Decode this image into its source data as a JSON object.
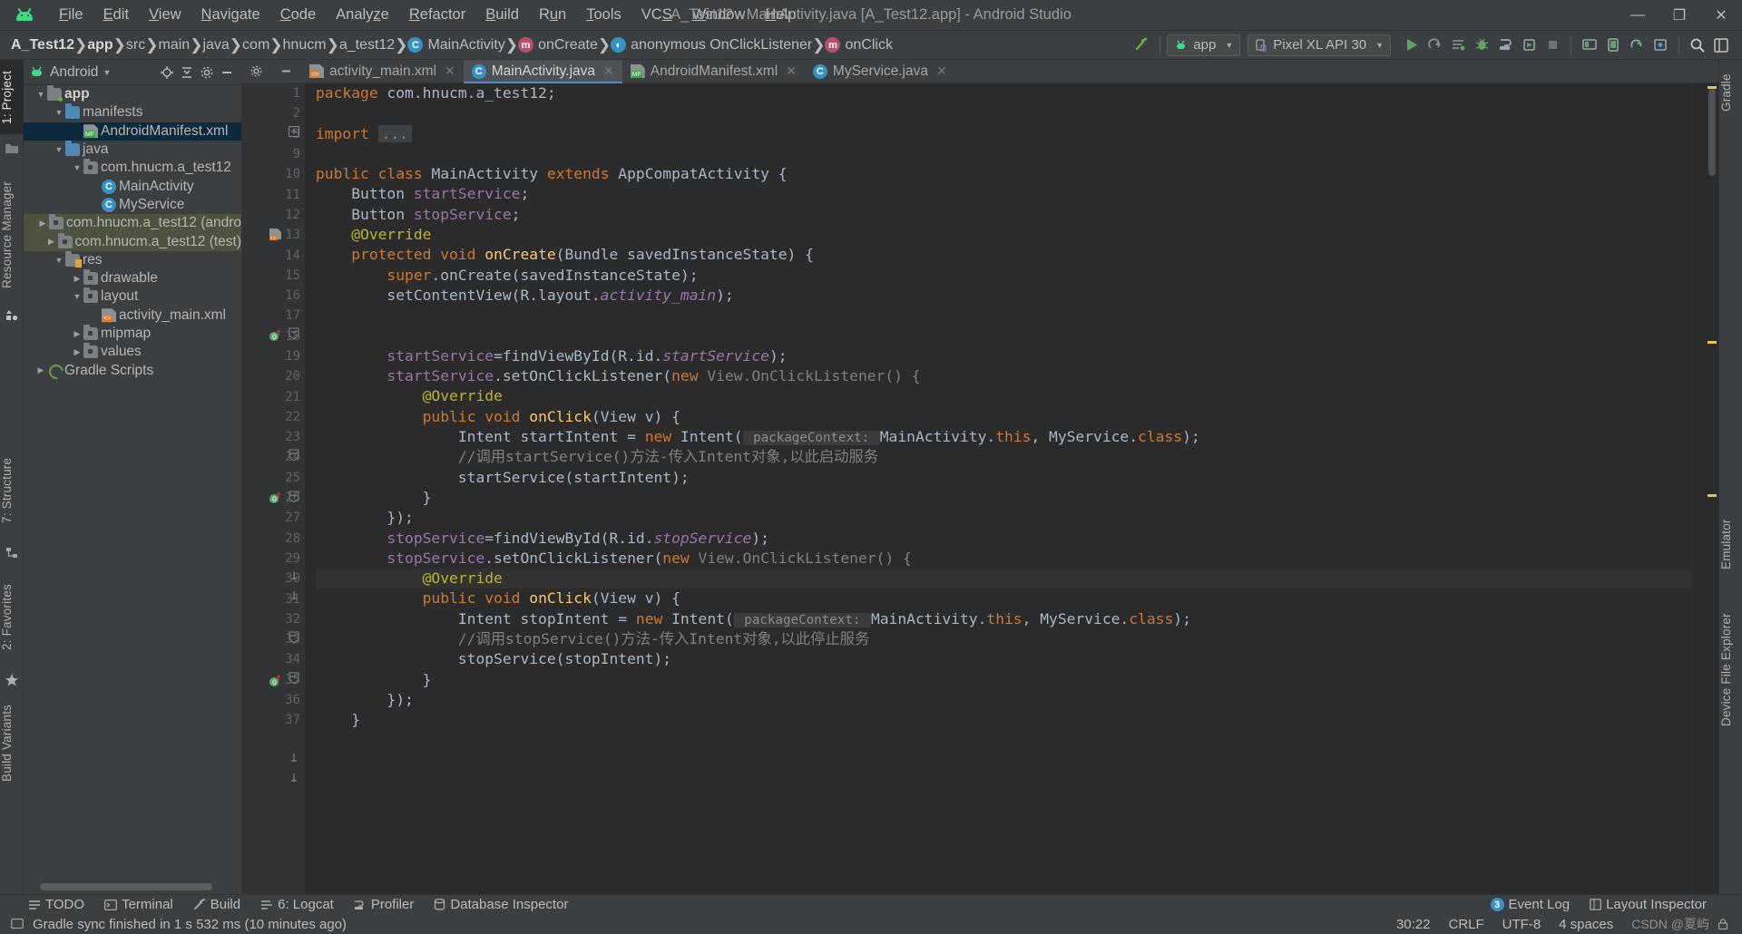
{
  "window": {
    "title": "A_Test12 - MainActivity.java [A_Test12.app] - Android Studio",
    "minimize": "—",
    "maximize": "❐",
    "close": "✕"
  },
  "menu": [
    {
      "label": "File"
    },
    {
      "label": "Edit"
    },
    {
      "label": "View"
    },
    {
      "label": "Navigate"
    },
    {
      "label": "Code"
    },
    {
      "label": "Analyze"
    },
    {
      "label": "Refactor"
    },
    {
      "label": "Build"
    },
    {
      "label": "Run"
    },
    {
      "label": "Tools"
    },
    {
      "label": "VCS"
    },
    {
      "label": "Window"
    },
    {
      "label": "Help"
    }
  ],
  "breadcrumbs": [
    {
      "label": "A_Test12",
      "icon": "none",
      "bold": true
    },
    {
      "label": "app",
      "icon": "none",
      "bold": true
    },
    {
      "label": "src",
      "icon": "none",
      "bold": false
    },
    {
      "label": "main",
      "icon": "none",
      "bold": false
    },
    {
      "label": "java",
      "icon": "none",
      "bold": false
    },
    {
      "label": "com",
      "icon": "none",
      "bold": false
    },
    {
      "label": "hnucm",
      "icon": "none",
      "bold": false
    },
    {
      "label": "a_test12",
      "icon": "none",
      "bold": false
    },
    {
      "label": "MainActivity",
      "icon": "class-icon",
      "bold": false
    },
    {
      "label": "onCreate",
      "icon": "method-icon",
      "bold": false
    },
    {
      "label": "anonymous OnClickListener",
      "icon": "anonymous-class-icon",
      "bold": false
    },
    {
      "label": "onClick",
      "icon": "method-icon",
      "bold": false
    }
  ],
  "toolbar": {
    "module_combo": "app",
    "device_combo": "Pixel XL API 30",
    "icons": [
      "run-icon",
      "apply-changes-icon",
      "apply-code-changes-icon",
      "debug-icon",
      "profile-icon",
      "attach-debugger-icon",
      "stop-icon",
      "sdk-manager-icon",
      "avd-manager-icon",
      "sync-gradle-icon",
      "avd-icon",
      "search-icon",
      "layout-editor-icon"
    ]
  },
  "left_tool_strip": [
    {
      "label": "1: Project",
      "selected": true
    },
    {
      "label": "Resource Manager",
      "selected": false
    },
    {
      "label": "7: Structure",
      "selected": false
    },
    {
      "label": "2: Favorites",
      "selected": false
    },
    {
      "label": "Build Variants",
      "selected": false
    }
  ],
  "right_tool_strip": [
    {
      "label": "Gradle"
    },
    {
      "label": "Emulator"
    },
    {
      "label": "Device File Explorer"
    }
  ],
  "project_panel": {
    "view_selector": "Android",
    "actions": [
      "locate-icon",
      "collapse-all-icon",
      "settings-icon",
      "hide-icon"
    ],
    "tree": [
      {
        "indent": 0,
        "arrow": "▼",
        "icon": "module-folder",
        "label": "app",
        "bold": true,
        "state": "normal"
      },
      {
        "indent": 1,
        "arrow": "▼",
        "icon": "folder",
        "label": "manifests",
        "bold": false,
        "state": "normal"
      },
      {
        "indent": 2,
        "arrow": "",
        "icon": "xml-manifest",
        "label": "AndroidManifest.xml",
        "bold": false,
        "state": "selected"
      },
      {
        "indent": 1,
        "arrow": "▼",
        "icon": "folder",
        "label": "java",
        "bold": false,
        "state": "normal"
      },
      {
        "indent": 2,
        "arrow": "▼",
        "icon": "package",
        "label": "com.hnucm.a_test12",
        "bold": false,
        "state": "normal"
      },
      {
        "indent": 3,
        "arrow": "",
        "icon": "java-class",
        "label": "MainActivity",
        "bold": false,
        "state": "normal"
      },
      {
        "indent": 3,
        "arrow": "",
        "icon": "java-class",
        "label": "MyService",
        "bold": false,
        "state": "normal"
      },
      {
        "indent": 2,
        "arrow": "▶",
        "icon": "package",
        "label": "com.hnucm.a_test12 (andro",
        "bold": false,
        "state": "group"
      },
      {
        "indent": 2,
        "arrow": "▶",
        "icon": "package",
        "label": "com.hnucm.a_test12 (test)",
        "bold": false,
        "state": "group"
      },
      {
        "indent": 1,
        "arrow": "▼",
        "icon": "res-folder",
        "label": "res",
        "bold": false,
        "state": "normal"
      },
      {
        "indent": 2,
        "arrow": "▶",
        "icon": "package",
        "label": "drawable",
        "bold": false,
        "state": "normal"
      },
      {
        "indent": 2,
        "arrow": "▼",
        "icon": "package",
        "label": "layout",
        "bold": false,
        "state": "normal"
      },
      {
        "indent": 3,
        "arrow": "",
        "icon": "xml-layout",
        "label": "activity_main.xml",
        "bold": false,
        "state": "normal"
      },
      {
        "indent": 2,
        "arrow": "▶",
        "icon": "package",
        "label": "mipmap",
        "bold": false,
        "state": "normal"
      },
      {
        "indent": 2,
        "arrow": "▶",
        "icon": "package",
        "label": "values",
        "bold": false,
        "state": "normal"
      },
      {
        "indent": 0,
        "arrow": "▶",
        "icon": "gradle",
        "label": "Gradle Scripts",
        "bold": false,
        "state": "normal"
      }
    ]
  },
  "editor": {
    "tabs": [
      {
        "label": "activity_main.xml",
        "icon": "xml-layout-icon",
        "active": false
      },
      {
        "label": "MainActivity.java",
        "icon": "java-class-icon",
        "active": true
      },
      {
        "label": "AndroidManifest.xml",
        "icon": "xml-manifest-icon",
        "active": false
      },
      {
        "label": "MyService.java",
        "icon": "java-class-icon",
        "active": false
      }
    ],
    "line_numbers": [
      1,
      2,
      3,
      9,
      10,
      11,
      12,
      13,
      14,
      15,
      16,
      17,
      18,
      19,
      20,
      21,
      22,
      23,
      24,
      25,
      26,
      27,
      28,
      29,
      30,
      31,
      32,
      33,
      34,
      35,
      36,
      37
    ],
    "current_line": 30,
    "code_lines": [
      {
        "n": 1,
        "tokens": [
          {
            "t": "package ",
            "c": "k"
          },
          {
            "t": "com.hnucm.a_test12;",
            "c": "plain"
          }
        ]
      },
      {
        "n": 2,
        "tokens": []
      },
      {
        "n": 3,
        "tokens": [
          {
            "t": "import ",
            "c": "k"
          },
          {
            "t": "...",
            "c": "dots"
          }
        ]
      },
      {
        "n": 9,
        "tokens": []
      },
      {
        "n": 10,
        "tokens": [
          {
            "t": "public class ",
            "c": "k"
          },
          {
            "t": "MainActivity ",
            "c": "plain"
          },
          {
            "t": "extends ",
            "c": "k"
          },
          {
            "t": "AppCompatActivity {",
            "c": "plain"
          }
        ]
      },
      {
        "n": 11,
        "tokens": [
          {
            "t": "    Button ",
            "c": "plain"
          },
          {
            "t": "startService",
            "c": "fld"
          },
          {
            "t": ";",
            "c": "plain"
          }
        ]
      },
      {
        "n": 12,
        "tokens": [
          {
            "t": "    Button ",
            "c": "plain"
          },
          {
            "t": "stopService",
            "c": "fld"
          },
          {
            "t": ";",
            "c": "plain"
          }
        ]
      },
      {
        "n": 13,
        "tokens": [
          {
            "t": "    @Override",
            "c": "ann"
          }
        ]
      },
      {
        "n": 14,
        "tokens": [
          {
            "t": "    protected void ",
            "c": "k"
          },
          {
            "t": "onCreate",
            "c": "mth"
          },
          {
            "t": "(Bundle savedInstanceState) {",
            "c": "plain"
          }
        ]
      },
      {
        "n": 15,
        "tokens": [
          {
            "t": "        super",
            "c": "k"
          },
          {
            "t": ".onCreate(savedInstanceState);",
            "c": "plain"
          }
        ]
      },
      {
        "n": 16,
        "tokens": [
          {
            "t": "        setContentView(R.layout.",
            "c": "plain"
          },
          {
            "t": "activity_main",
            "c": "sfld"
          },
          {
            "t": ");",
            "c": "plain"
          }
        ]
      },
      {
        "n": 17,
        "tokens": []
      },
      {
        "n": 18,
        "tokens": []
      },
      {
        "n": 19,
        "tokens": [
          {
            "t": "        ",
            "c": "plain"
          },
          {
            "t": "startService",
            "c": "fld"
          },
          {
            "t": "=findViewById(R.id.",
            "c": "plain"
          },
          {
            "t": "startService",
            "c": "sfld"
          },
          {
            "t": ");",
            "c": "plain"
          }
        ]
      },
      {
        "n": 20,
        "tokens": [
          {
            "t": "        ",
            "c": "plain"
          },
          {
            "t": "startService",
            "c": "fld"
          },
          {
            "t": ".setOnClickListener(",
            "c": "plain"
          },
          {
            "t": "new ",
            "c": "k"
          },
          {
            "t": "View.OnClickListener() {",
            "c": "gry"
          }
        ]
      },
      {
        "n": 21,
        "tokens": [
          {
            "t": "            @Override",
            "c": "ann"
          }
        ]
      },
      {
        "n": 22,
        "tokens": [
          {
            "t": "            public void ",
            "c": "k"
          },
          {
            "t": "onClick",
            "c": "mth"
          },
          {
            "t": "(View v) {",
            "c": "plain"
          }
        ]
      },
      {
        "n": 23,
        "tokens": [
          {
            "t": "                Intent startIntent = ",
            "c": "plain"
          },
          {
            "t": "new ",
            "c": "k"
          },
          {
            "t": "Intent(",
            "c": "plain"
          },
          {
            "t": " packageContext: ",
            "c": "hint"
          },
          {
            "t": "MainActivity.",
            "c": "plain"
          },
          {
            "t": "this",
            "c": "k"
          },
          {
            "t": ", MyService.",
            "c": "plain"
          },
          {
            "t": "class",
            "c": "k"
          },
          {
            "t": ");",
            "c": "plain"
          }
        ]
      },
      {
        "n": 24,
        "tokens": [
          {
            "t": "                //调用startService()方法-传入Intent对象,以此启动服务",
            "c": "cmt"
          }
        ]
      },
      {
        "n": 25,
        "tokens": [
          {
            "t": "                startService(startIntent);",
            "c": "plain"
          }
        ]
      },
      {
        "n": 26,
        "tokens": [
          {
            "t": "            }",
            "c": "plain"
          }
        ]
      },
      {
        "n": 27,
        "tokens": [
          {
            "t": "        });",
            "c": "plain"
          }
        ]
      },
      {
        "n": 28,
        "tokens": [
          {
            "t": "        ",
            "c": "plain"
          },
          {
            "t": "stopService",
            "c": "fld"
          },
          {
            "t": "=findViewById(R.id.",
            "c": "plain"
          },
          {
            "t": "stopService",
            "c": "sfld"
          },
          {
            "t": ");",
            "c": "plain"
          }
        ]
      },
      {
        "n": 29,
        "tokens": [
          {
            "t": "        ",
            "c": "plain"
          },
          {
            "t": "stopService",
            "c": "fld"
          },
          {
            "t": ".setOnClickListener(",
            "c": "plain"
          },
          {
            "t": "new ",
            "c": "k"
          },
          {
            "t": "View.OnClickListener() {",
            "c": "gry"
          }
        ]
      },
      {
        "n": 30,
        "tokens": [
          {
            "t": "            @Override",
            "c": "ann"
          }
        ]
      },
      {
        "n": 31,
        "tokens": [
          {
            "t": "            public void ",
            "c": "k"
          },
          {
            "t": "onClick",
            "c": "mth"
          },
          {
            "t": "(View v) {",
            "c": "plain"
          }
        ]
      },
      {
        "n": 32,
        "tokens": [
          {
            "t": "                Intent stopIntent = ",
            "c": "plain"
          },
          {
            "t": "new ",
            "c": "k"
          },
          {
            "t": "Intent(",
            "c": "plain"
          },
          {
            "t": " packageContext: ",
            "c": "hint"
          },
          {
            "t": "MainActivity.",
            "c": "plain"
          },
          {
            "t": "this",
            "c": "k"
          },
          {
            "t": ", MyService.",
            "c": "plain"
          },
          {
            "t": "class",
            "c": "k"
          },
          {
            "t": ");",
            "c": "plain"
          }
        ]
      },
      {
        "n": 33,
        "tokens": [
          {
            "t": "                //调用stopService()方法-传入Intent对象,以此停止服务",
            "c": "cmt"
          }
        ]
      },
      {
        "n": 34,
        "tokens": [
          {
            "t": "                stopService(stopIntent);",
            "c": "plain"
          }
        ]
      },
      {
        "n": 35,
        "tokens": [
          {
            "t": "            }",
            "c": "plain"
          }
        ]
      },
      {
        "n": 36,
        "tokens": [
          {
            "t": "        });",
            "c": "plain"
          }
        ]
      },
      {
        "n": 37,
        "tokens": [
          {
            "t": "    }",
            "c": "plain"
          }
        ]
      }
    ]
  },
  "bottom_bar": {
    "items": [
      {
        "label": "TODO",
        "icon": "todo-icon"
      },
      {
        "label": "Terminal",
        "icon": "terminal-icon"
      },
      {
        "label": "Build",
        "icon": "build-icon"
      },
      {
        "label": "6: Logcat",
        "icon": "logcat-icon"
      },
      {
        "label": "Profiler",
        "icon": "profiler-icon"
      },
      {
        "label": "Database Inspector",
        "icon": "database-icon"
      }
    ],
    "event_log": {
      "label": "Event Log",
      "count": "3"
    },
    "layout_inspector": "Layout Inspector"
  },
  "status_bar": {
    "message": "Gradle sync finished in 1 s 532 ms (10 minutes ago)",
    "caret": "30:22",
    "line_sep": "CRLF",
    "encoding": "UTF-8",
    "indent": "4 spaces",
    "watermark": "CSDN @夏屿"
  },
  "colors": {
    "accent": "#3592c4",
    "android_green": "#3ddc84",
    "selection": "#0d293e",
    "group_row": "#4e533f",
    "editor_bg": "#2b2b2b",
    "chrome_bg": "#3c3f41"
  }
}
